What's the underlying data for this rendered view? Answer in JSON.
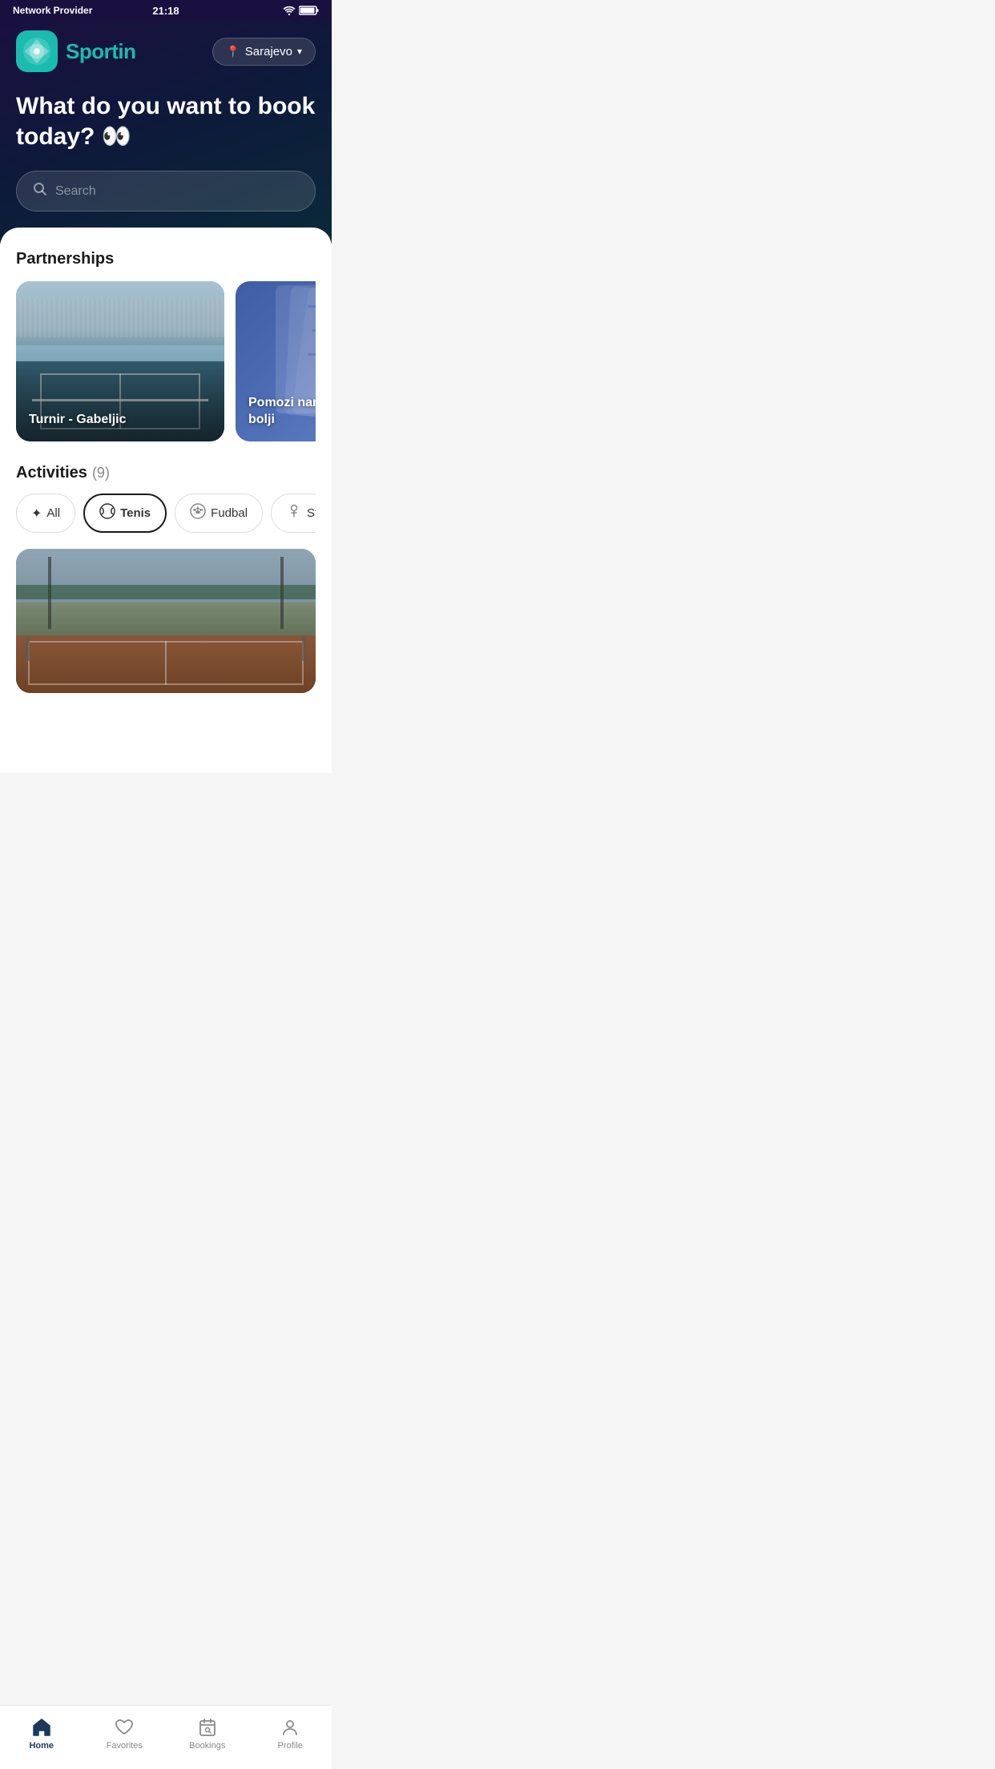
{
  "statusBar": {
    "carrier": "Network Provider",
    "time": "21:18",
    "battery": "▮▮▮▮"
  },
  "header": {
    "logoText": "Sport",
    "logoAccent": "in",
    "locationLabel": "Sarajevo"
  },
  "hero": {
    "title": "What do you want to book today? 👀",
    "searchPlaceholder": "Search"
  },
  "partnerships": {
    "sectionTitle": "Partnerships",
    "cards": [
      {
        "id": 1,
        "label": "Turnir - Gabeljic",
        "type": "stadium"
      },
      {
        "id": 2,
        "label": "Pomozi nam da budemo bolji",
        "type": "survey"
      }
    ]
  },
  "activities": {
    "sectionTitle": "Activities",
    "count": "(9)",
    "filters": [
      {
        "id": "all",
        "label": "All",
        "icon": "✦",
        "active": false
      },
      {
        "id": "tenis",
        "label": "Tenis",
        "icon": "🎾",
        "active": true
      },
      {
        "id": "fudbal",
        "label": "Fudbal",
        "icon": "⚽",
        "active": false
      },
      {
        "id": "squash",
        "label": "St...",
        "icon": "🏃",
        "active": false
      }
    ]
  },
  "bottomNav": {
    "items": [
      {
        "id": "home",
        "label": "Home",
        "active": true
      },
      {
        "id": "favorites",
        "label": "Favorites",
        "active": false
      },
      {
        "id": "bookings",
        "label": "Bookings",
        "active": false
      },
      {
        "id": "profile",
        "label": "Profile",
        "active": false
      }
    ]
  }
}
